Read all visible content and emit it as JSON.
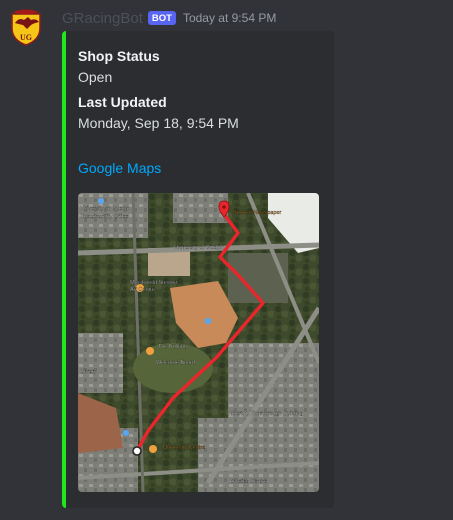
{
  "message": {
    "username": "GRacingBot",
    "bot_tag": "BOT",
    "timestamp": "Today at 9:54 PM",
    "avatar_icon": "eagle-crest-icon"
  },
  "embed": {
    "accent_color": "#22e51b",
    "fields": [
      {
        "name": "Shop Status",
        "value": "Open"
      },
      {
        "name": "Last Updated",
        "value": "Monday, Sep 18, 9:54 PM"
      }
    ],
    "link_text": "Google Maps",
    "map": {
      "type": "satellite",
      "route_color": "#e8262b",
      "labels": [
        "Student Newspaper",
        "University of Guelph",
        "Sustainability Office",
        "University of Guelph",
        "Macdonald Stewart",
        "Art Centre",
        "The Bullring",
        "Welcome Board",
        "Albert A. Thornbrough Building",
        "Library",
        "University Centre",
        "Athletics Centre"
      ]
    }
  }
}
